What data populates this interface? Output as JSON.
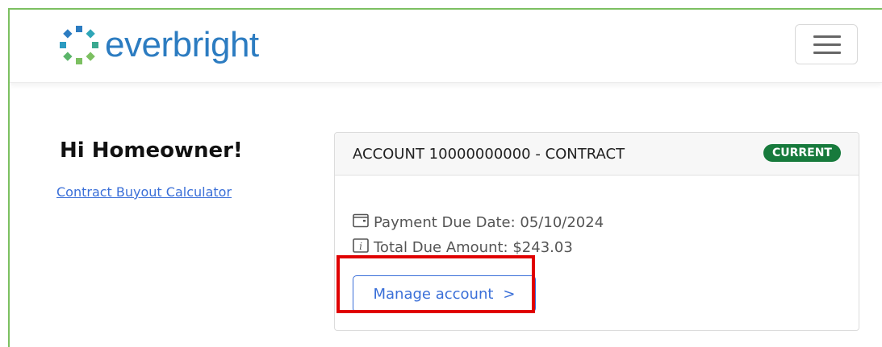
{
  "header": {
    "logo_text": "everbright",
    "colors": {
      "brand_blue": "#2c7cc1",
      "brand_green": "#7cc061",
      "brand_teal": "#2fa6b8"
    }
  },
  "sidebar": {
    "greeting": "Hi Homeowner!",
    "calculator_link": "Contract Buyout Calculator"
  },
  "account_card": {
    "title": "ACCOUNT 10000000000 - CONTRACT",
    "status": "CURRENT",
    "status_color": "#177a3c",
    "payment_due": "Payment Due Date: 05/10/2024",
    "total_due": "Total Due Amount: $243.03",
    "manage_label": "Manage account",
    "manage_chevron": ">"
  },
  "icons": [
    "menu-icon",
    "calendar-icon",
    "info-icon",
    "chevron-right-icon"
  ],
  "annotation": {
    "highlight_color": "#e00000"
  }
}
